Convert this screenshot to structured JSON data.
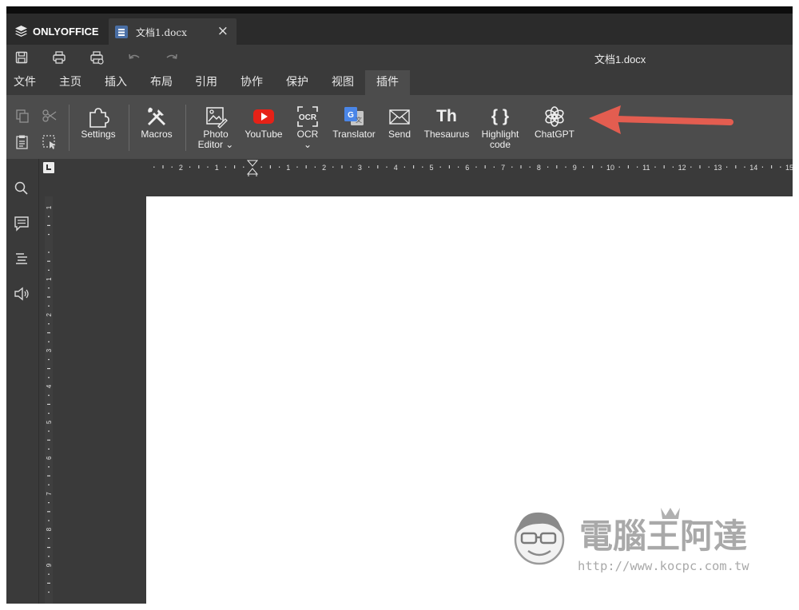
{
  "app": {
    "brand": "ONLYOFFICE",
    "tab_title": "文档1.docx",
    "tab_close": "×",
    "doc_title": "文档1.docx"
  },
  "quick_access": [
    "save",
    "print",
    "quick-print",
    "undo",
    "redo"
  ],
  "menu_tabs": [
    "文件",
    "主页",
    "插入",
    "布局",
    "引用",
    "协作",
    "保护",
    "视图",
    "插件"
  ],
  "active_menu_tab": "插件",
  "toolbar": {
    "settings": "Settings",
    "macros": "Macros",
    "photo_editor_1": "Photo",
    "photo_editor_2": "Editor ⌄",
    "youtube": "YouTube",
    "ocr": "OCR",
    "ocr_caret": "⌄",
    "translator": "Translator",
    "send": "Send",
    "thesaurus": "Thesaurus",
    "thesaurus_glyph": "Th",
    "highlight_1": "Highlight",
    "highlight_2": "code",
    "highlight_glyph": "{ }",
    "chatgpt": "ChatGPT"
  },
  "ruler": {
    "h_numbers": [
      "2",
      "1",
      "1",
      "2",
      "3",
      "4",
      "5",
      "6",
      "7",
      "8",
      "9",
      "10",
      "11",
      "12",
      "13",
      "14",
      "15"
    ],
    "v_numbers": [
      "1",
      "1",
      "2",
      "3",
      "4",
      "5",
      "6",
      "7",
      "8",
      "9"
    ]
  },
  "watermark": {
    "title": "電腦王阿達",
    "url": "http://www.kocpc.com.tw"
  },
  "colors": {
    "youtube_red": "#e62117",
    "translator_blue": "#4a86e8",
    "arrow_red": "#e35d50",
    "active_tab": "#4c4c4c"
  }
}
